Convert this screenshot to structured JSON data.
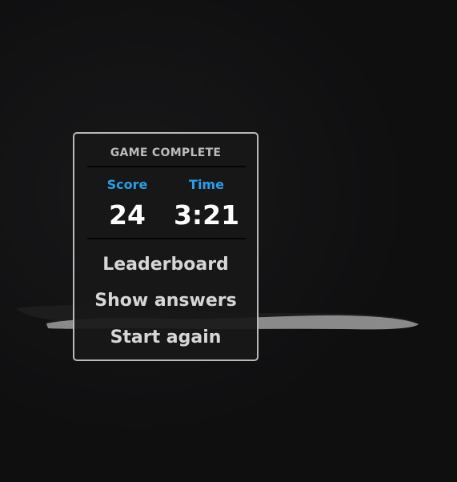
{
  "dialog": {
    "title": "GAME COMPLETE",
    "score_label": "Score",
    "score_value": "24",
    "time_label": "Time",
    "time_value": "3:21"
  },
  "menu": {
    "leaderboard": "Leaderboard",
    "show_answers": "Show answers",
    "start_again": "Start again"
  },
  "colors": {
    "background": "#0f0f10",
    "accent": "#2a9ee8",
    "panel_border": "#b9b9b9",
    "menu_text": "#d6d6d6",
    "stroke": "#8a8a8a"
  }
}
